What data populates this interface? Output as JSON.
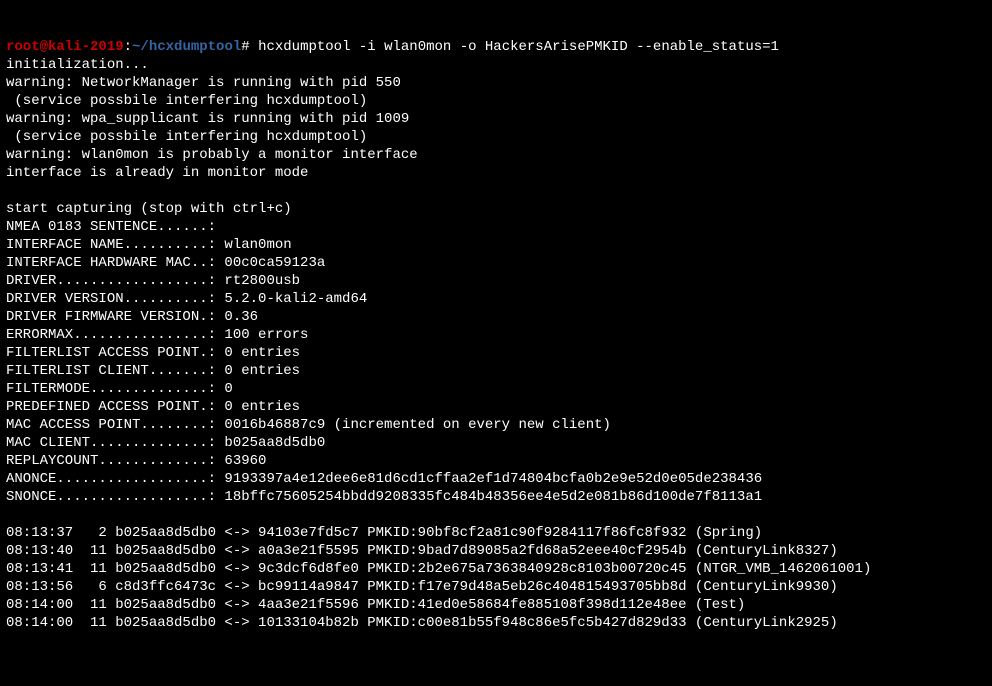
{
  "prompt": {
    "user": "root@kali-2019",
    "colon": ":",
    "path": "~/hcxdumptool",
    "hash": "# ",
    "command": "hcxdumptool -i wlan0mon -o HackersArisePMKID --enable_status=1"
  },
  "lines": {
    "l1": "initialization...",
    "l2": "warning: NetworkManager is running with pid 550",
    "l3": " (service possbile interfering hcxdumptool)",
    "l4": "warning: wpa_supplicant is running with pid 1009",
    "l5": " (service possbile interfering hcxdumptool)",
    "l6": "warning: wlan0mon is probably a monitor interface",
    "l7": "interface is already in monitor mode",
    "l8": "",
    "l9": "start capturing (stop with ctrl+c)",
    "l10": "NMEA 0183 SENTENCE......:",
    "l11": "INTERFACE NAME..........: wlan0mon",
    "l12": "INTERFACE HARDWARE MAC..: 00c0ca59123a",
    "l13": "DRIVER..................: rt2800usb",
    "l14": "DRIVER VERSION..........: 5.2.0-kali2-amd64",
    "l15": "DRIVER FIRMWARE VERSION.: 0.36",
    "l16": "ERRORMAX................: 100 errors",
    "l17": "FILTERLIST ACCESS POINT.: 0 entries",
    "l18": "FILTERLIST CLIENT.......: 0 entries",
    "l19": "FILTERMODE..............: 0",
    "l20": "PREDEFINED ACCESS POINT.: 0 entries",
    "l21": "MAC ACCESS POINT........: 0016b46887c9 (incremented on every new client)",
    "l22": "MAC CLIENT..............: b025aa8d5db0",
    "l23": "REPLAYCOUNT.............: 63960",
    "l24": "ANONCE..................: 9193397a4e12dee6e81d6cd1cffaa2ef1d74804bcfa0b2e9e52d0e05de238436",
    "l25": "SNONCE..................: 18bffc75605254bbdd9208335fc484b48356ee4e5d2e081b86d100de7f8113a1",
    "l26": "",
    "l27": "08:13:37   2 b025aa8d5db0 <-> 94103e7fd5c7 PMKID:90bf8cf2a81c90f9284117f86fc8f932 (Spring)",
    "l28": "08:13:40  11 b025aa8d5db0 <-> a0a3e21f5595 PMKID:9bad7d89085a2fd68a52eee40cf2954b (CenturyLink8327)",
    "l29": "08:13:41  11 b025aa8d5db0 <-> 9c3dcf6d8fe0 PMKID:2b2e675a7363840928c8103b00720c45 (NTGR_VMB_1462061001)",
    "l30": "08:13:56   6 c8d3ffc6473c <-> bc99114a9847 PMKID:f17e79d48a5eb26c404815493705bb8d (CenturyLink9930)",
    "l31": "08:14:00  11 b025aa8d5db0 <-> 4aa3e21f5596 PMKID:41ed0e58684fe885108f398d112e48ee (Test)",
    "l32": "08:14:00  11 b025aa8d5db0 <-> 10133104b82b PMKID:c00e81b55f948c86e5fc5b427d829d33 (CenturyLink2925)"
  }
}
